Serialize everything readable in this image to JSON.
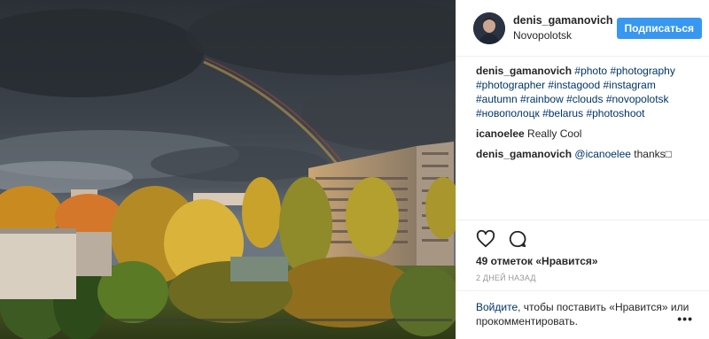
{
  "post": {
    "username": "denis_gamanovich",
    "location": "Novopolotsk",
    "follow_label": "Подписаться"
  },
  "caption": {
    "username": "denis_gamanovich",
    "hashtags": [
      "#photo",
      "#photography",
      "#photographer",
      "#instagood",
      "#instagram",
      "#autumn",
      "#rainbow",
      "#clouds",
      "#novopolotsk",
      "#новополоцк",
      "#belarus",
      "#photoshoot"
    ]
  },
  "comments": [
    {
      "username": "icanoelee",
      "text": "Really Cool"
    },
    {
      "username": "denis_gamanovich",
      "mention": "@icanoelee",
      "text": "thanks□"
    }
  ],
  "actions": {
    "like_icon": "heart-icon",
    "comment_icon": "comment-icon"
  },
  "likes_text": "49 отметок «Нравится»",
  "time_text": "2 ДНЕЙ НАЗАД",
  "footer": {
    "login_link": "Войдите",
    "text": ", чтобы поставить «Нравится» или прокомментировать."
  },
  "more_label": "•••",
  "colors": {
    "accent": "#3897f0",
    "link": "#003569",
    "muted": "#999999"
  }
}
